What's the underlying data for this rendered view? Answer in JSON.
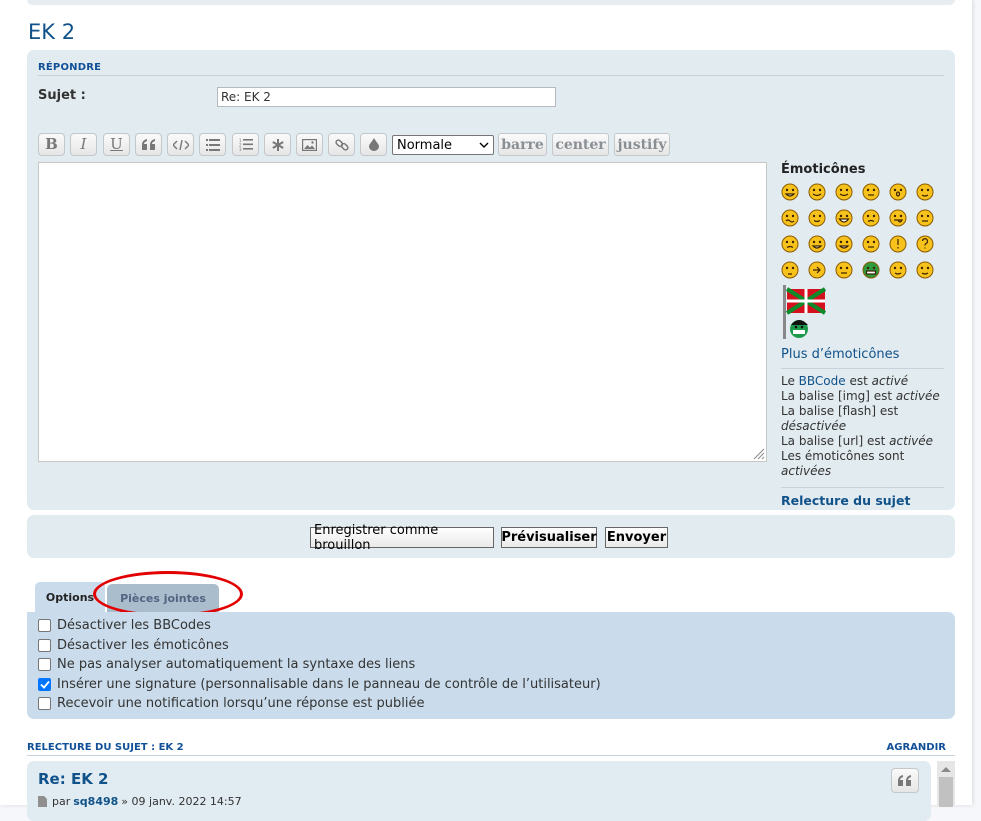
{
  "topic_title": "EK 2",
  "reply": {
    "heading": "RÉPONDRE",
    "subject_label": "Sujet :",
    "subject_value": "Re: EK 2"
  },
  "toolbar": {
    "buttons": [
      "bold-icon",
      "italic-icon",
      "underline-icon",
      "quote-icon",
      "code-icon",
      "list-icon",
      "numbered-list-icon",
      "list-item-icon",
      "image-icon",
      "link-icon",
      "color-icon"
    ],
    "bold_glyph": "B",
    "italic_glyph": "I",
    "underline_glyph": "U",
    "font_size_selected": "Normale",
    "custom_tags": [
      "barre",
      "center",
      "justify"
    ]
  },
  "smilies": {
    "title": "Émoticônes",
    "more_label": "Plus d’émoticônes",
    "faces": [
      "grin",
      "smile",
      "wink",
      "sad-eyes",
      "shock",
      "nerd",
      "confused",
      "cool",
      "laugh",
      "mad",
      "razz",
      "embarrassed",
      "cry",
      "evil",
      "twisted",
      "roll-eyes",
      "exclamation",
      "question",
      "idea",
      "arrow",
      "neutral",
      "green-mrgreen",
      "geek",
      "ugeek"
    ]
  },
  "bbcode_status": {
    "line1_pre": "Le ",
    "line1_link": "BBCode",
    "line1_mid": " est ",
    "line1_state": "activé",
    "line2_pre": "La balise [img] est ",
    "line2_state": "activée",
    "line3_pre": "La balise [flash] est ",
    "line3_state": "désactivée",
    "line4_pre": "La balise [url] est ",
    "line4_state": "activée",
    "line5_pre": "Les émoticônes sont ",
    "line5_state": "activées",
    "topic_review_link": "Relecture du sujet"
  },
  "actions": {
    "save_draft": "Enregistrer comme brouillon",
    "preview": "Prévisualiser",
    "submit": "Envoyer"
  },
  "tabs": {
    "options": "Options",
    "attachments": "Pièces jointes"
  },
  "options": [
    {
      "label": "Désactiver les BBCodes",
      "checked": false
    },
    {
      "label": "Désactiver les émoticônes",
      "checked": false
    },
    {
      "label": "Ne pas analyser automatiquement la syntaxe des liens",
      "checked": false
    },
    {
      "label": "Insérer une signature (personnalisable dans le panneau de contrôle de l’utilisateur)",
      "checked": true
    },
    {
      "label": "Recevoir une notification lorsqu’une réponse est publiée",
      "checked": false
    }
  ],
  "topic_review": {
    "heading": "RELECTURE DU SUJET : EK 2",
    "expand": "AGRANDIR",
    "post_title": "Re: EK 2",
    "post_by": "par",
    "post_author": "sq8498",
    "post_sep": "»",
    "post_date": "09 janv. 2022 14:57"
  },
  "colors": {
    "link": "#105289",
    "panel": "#e2ebf0",
    "options_panel": "#cadceb",
    "highlight": "#e20000",
    "checkbox_checked": "#0075ff"
  }
}
